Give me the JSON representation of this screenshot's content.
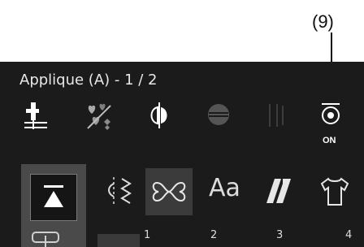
{
  "callout": {
    "label": "(9)"
  },
  "screen": {
    "title": "Applique (A) - 1 / 2",
    "toggle_state": "ON",
    "tabs": [
      "Aa"
    ],
    "pages": [
      "1",
      "2",
      "3",
      "4"
    ]
  },
  "icons": [
    "needle-position-icon",
    "hearts-icon",
    "mirror-icon",
    "stitch-width-icon",
    "tension-icon",
    "needle-stop-icon",
    "home-icon",
    "stitch-category-icon",
    "decorative-stitch-icon",
    "letters-icon",
    "quilt-icon",
    "shirt-icon",
    "presser-foot-icon"
  ],
  "colors": {
    "screen_bg": "#1b1b1b",
    "icon_white": "#ffffff",
    "icon_gray": "#9a9a9a",
    "dim_gray": "#555555"
  }
}
